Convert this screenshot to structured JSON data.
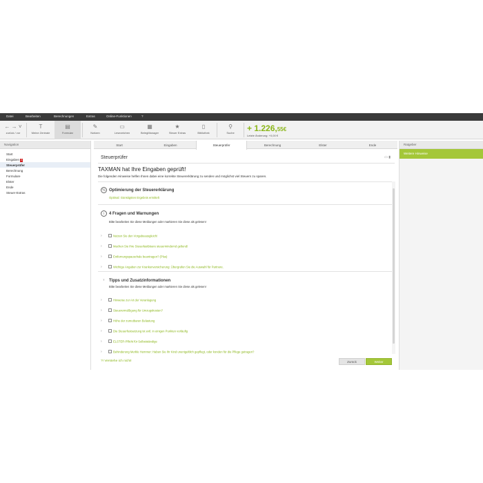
{
  "menu": [
    "Datei",
    "Bearbeiten",
    "Berechnungen",
    "Extras",
    "Online-Funktionen",
    "?"
  ],
  "toolbar": {
    "nav_label": "zurück / vor",
    "items": [
      {
        "label": "Meine Zentrale",
        "icon": "T"
      },
      {
        "label": "Formular",
        "icon": "▤"
      },
      {
        "label": "Notizen",
        "icon": "✎"
      },
      {
        "label": "Lesezeichen",
        "icon": "▭"
      },
      {
        "label": "BelegManager",
        "icon": "▦"
      },
      {
        "label": "Steuer Extras",
        "icon": "★"
      },
      {
        "label": "Bibliothek",
        "icon": "▯"
      },
      {
        "label": "Suche",
        "icon": "⚲"
      }
    ],
    "amount_main": "+ 1.226,",
    "amount_cents": "55€",
    "amount_sub": "Letzte Änderung: +0,00 €"
  },
  "nav": {
    "header": "Navigation",
    "items": [
      {
        "label": "Start",
        "badge": ""
      },
      {
        "label": "Eingaben",
        "badge": "3"
      },
      {
        "label": "Steuerprüfer",
        "badge": ""
      },
      {
        "label": "Berechnung",
        "badge": ""
      },
      {
        "label": "Formulare",
        "badge": ""
      },
      {
        "label": "Elster",
        "badge": ""
      },
      {
        "label": "Ende",
        "badge": ""
      },
      {
        "label": "Steuer-Extras",
        "badge": ""
      }
    ]
  },
  "tabs": [
    "Start",
    "Eingaben",
    "Steuerprüfer",
    "Berechnung",
    "Elster",
    "Ende"
  ],
  "main": {
    "title": "Steuerprüfer",
    "heading": "TAXMAN hat Ihre Eingaben geprüft!",
    "intro": "Die folgenden Hinweise helfen Ihnen dabei eine korrekte Steuererklärung zu senden und möglichst viel Steuern zu sparen.",
    "sections": {
      "opt_title": "Optimierung der Steuererklärung",
      "opt_link": "Optimal: Günstigsten Ergebnis ermittelt",
      "warn_title": "4 Fragen und Warnungen",
      "warn_sub": "Bitte bearbeiten Sie diese Meldungen oder markieren Sie diese als gelesen!",
      "warn_items": [
        "Nutzen Sie den Vorgabeausgleich!",
        "Machen Sie Ihre Steuerlastbisere steuermindernd geltend!",
        "Entfernungspauschale beantragen? (Plus)",
        "Wichtige Angaben zur Krankenversicherung: Übergrafen Sie die Auswahl für Partnere."
      ],
      "tips_title": "Tipps und Zusatzinformationen",
      "tips_sub": "Bitte bearbeiten Sie diese Meldungen oder markieren Sie diese als gelesen!",
      "tips_items": [
        "Hinweise zur Art der Veranlagung",
        "Steuerermäßigung für Umzugskosten?",
        "Höhe der zumutbaren Belastung",
        "Die Steuerfestsetzung ist evtl. in einigen Punkten vorläufig",
        "ELSTER-Pflicht für Selbstständige",
        "Behinderung Merkle Hemmer: Haben Sie Ihr Kind unentgeltlich gepflegt, oder konden für die Pflege getragen?"
      ]
    },
    "footer_help": "?! Verstehe ich nicht!",
    "back_label": "Zurück",
    "next_label": "Weiter"
  },
  "ratgeber": {
    "header": "Ratgeber",
    "panel": "Weitere Hinweise"
  }
}
